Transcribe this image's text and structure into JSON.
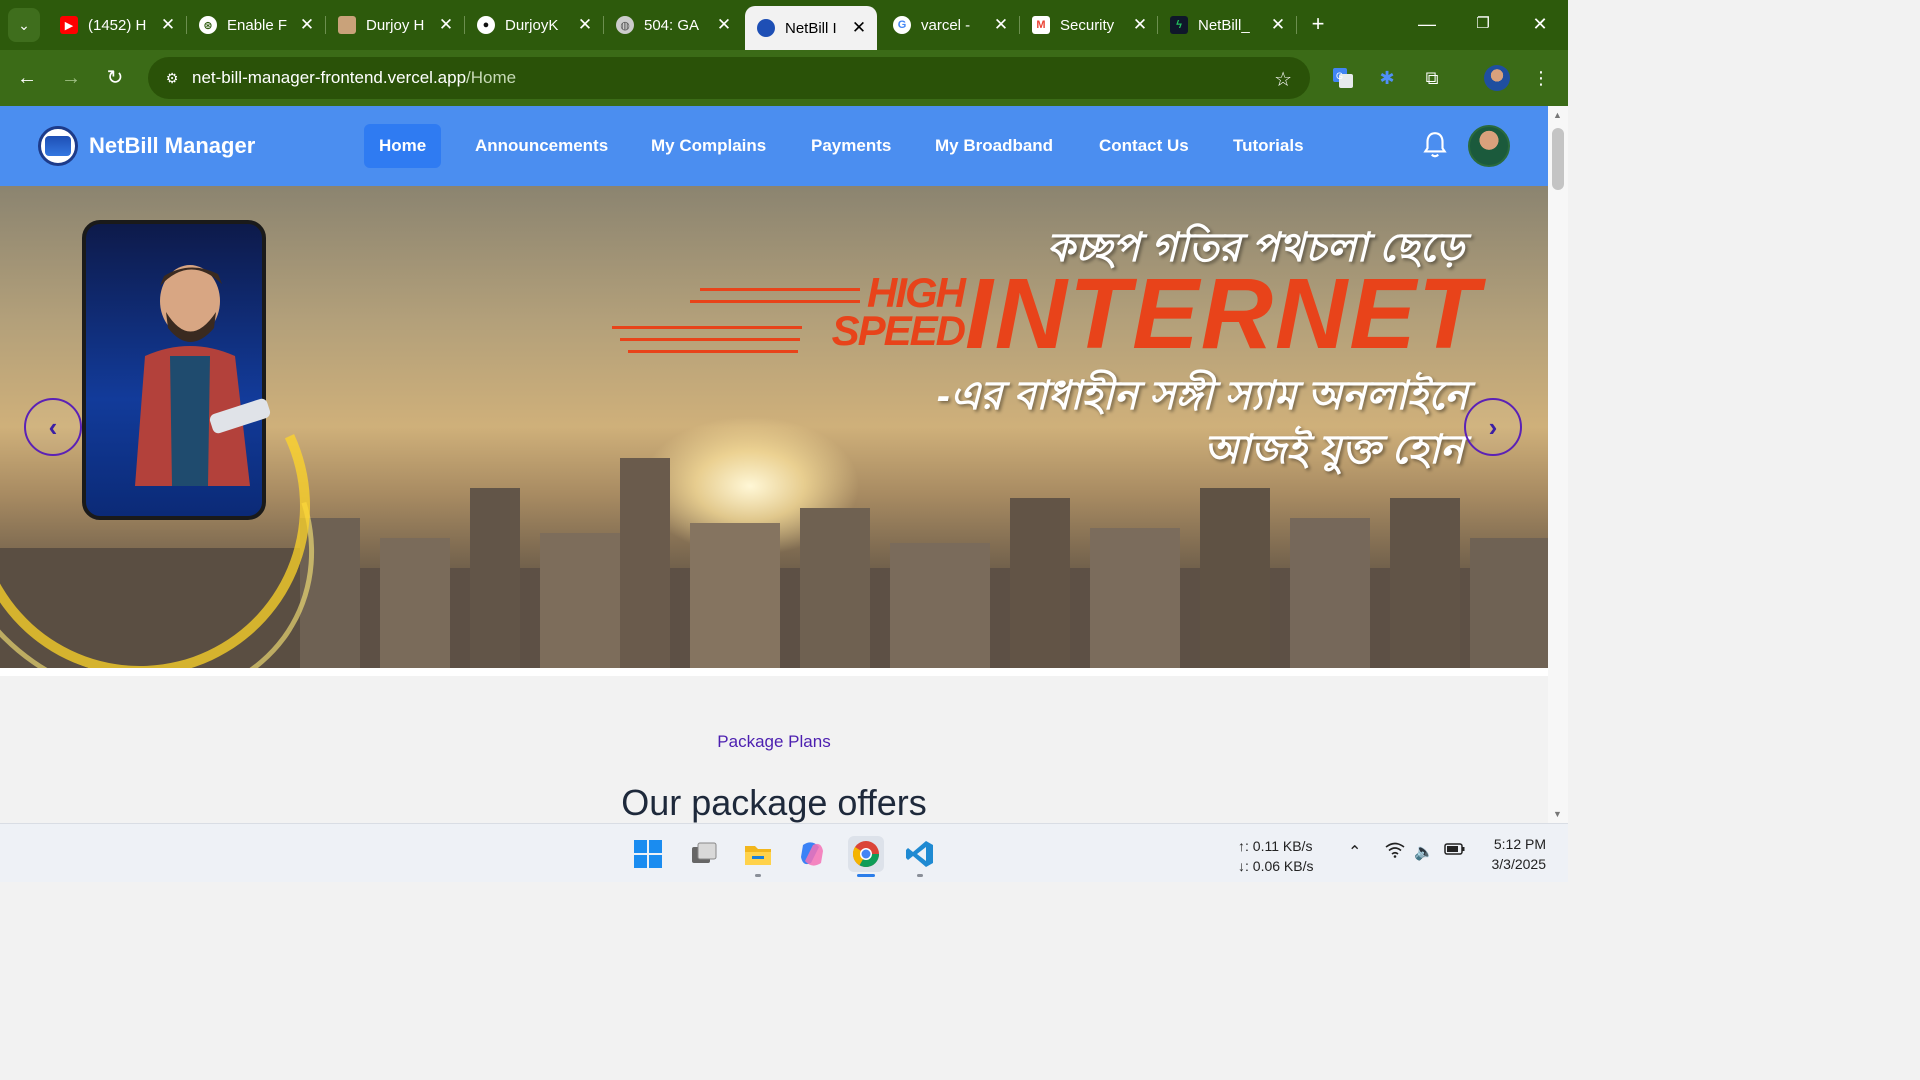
{
  "browser": {
    "tabs": [
      {
        "title": "(1452) H",
        "favicon": "youtube-icon",
        "color": "#ff0000"
      },
      {
        "title": "Enable F",
        "favicon": "openai-icon",
        "color": "#ffffff"
      },
      {
        "title": "Durjoy H",
        "favicon": "profile-photo-icon",
        "color": "#c9a27a"
      },
      {
        "title": "DurjoyK",
        "favicon": "github-icon",
        "color": "#ffffff"
      },
      {
        "title": "504: GA",
        "favicon": "globe-icon",
        "color": "#cccccc"
      },
      {
        "title": "NetBill I",
        "favicon": "netbill-icon",
        "color": "#1e4fb5",
        "active": true
      },
      {
        "title": "varcel -",
        "favicon": "google-icon",
        "color": "#4285f4"
      },
      {
        "title": "Security",
        "favicon": "gmail-icon",
        "color": "#ea4335"
      },
      {
        "title": "NetBill_",
        "favicon": "bolt-icon",
        "color": "#22c55e"
      }
    ],
    "url_host": "net-bill-manager-frontend.vercel.app",
    "url_path": "/Home"
  },
  "site": {
    "brand": "NetBill Manager",
    "nav": [
      {
        "label": "Home",
        "active": true
      },
      {
        "label": "Announcements"
      },
      {
        "label": "My Complains"
      },
      {
        "label": "Payments"
      },
      {
        "label": "My Broadband"
      },
      {
        "label": "Contact Us"
      },
      {
        "label": "Tutorials"
      }
    ],
    "accent": "#4b8ef0"
  },
  "hero": {
    "line1": "কচ্ছপ গতির পথচলা ছেড়ে",
    "high": "HIGH",
    "speed": "SPEED",
    "internet": "INTERNET",
    "line2": "-এর বাধাহীন সঙ্গী স্যাম অনলাইনে",
    "line3": "আজই যুক্ত হোন",
    "prev": "‹",
    "next": "›",
    "text_color": "#e8431a"
  },
  "section": {
    "eyebrow": "Package Plans",
    "title": "Our package offers"
  },
  "taskbar": {
    "upload": "↑: 0.11 KB/s",
    "download": "↓: 0.06 KB/s",
    "time": "5:12 PM",
    "date": "3/3/2025"
  }
}
